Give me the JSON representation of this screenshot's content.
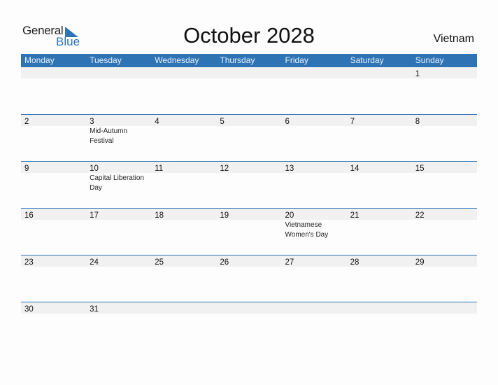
{
  "logo": {
    "general": "General",
    "blue": "Blue"
  },
  "title": "October 2028",
  "country": "Vietnam",
  "accent_color": "#2e74b5",
  "weekdays": [
    "Monday",
    "Tuesday",
    "Wednesday",
    "Thursday",
    "Friday",
    "Saturday",
    "Sunday"
  ],
  "weeks": [
    {
      "days": [
        "",
        "",
        "",
        "",
        "",
        "",
        "1"
      ],
      "events": [
        "",
        "",
        "",
        "",
        "",
        "",
        ""
      ]
    },
    {
      "days": [
        "2",
        "3",
        "4",
        "5",
        "6",
        "7",
        "8"
      ],
      "events": [
        "",
        "Mid-Autumn Festival",
        "",
        "",
        "",
        "",
        ""
      ]
    },
    {
      "days": [
        "9",
        "10",
        "11",
        "12",
        "13",
        "14",
        "15"
      ],
      "events": [
        "",
        "Capital Liberation Day",
        "",
        "",
        "",
        "",
        ""
      ]
    },
    {
      "days": [
        "16",
        "17",
        "18",
        "19",
        "20",
        "21",
        "22"
      ],
      "events": [
        "",
        "",
        "",
        "",
        "Vietnamese Women's Day",
        "",
        ""
      ]
    },
    {
      "days": [
        "23",
        "24",
        "25",
        "26",
        "27",
        "28",
        "29"
      ],
      "events": [
        "",
        "",
        "",
        "",
        "",
        "",
        ""
      ]
    },
    {
      "days": [
        "30",
        "31",
        "",
        "",
        "",
        "",
        ""
      ],
      "events": [
        "",
        "",
        "",
        "",
        "",
        "",
        ""
      ]
    }
  ]
}
